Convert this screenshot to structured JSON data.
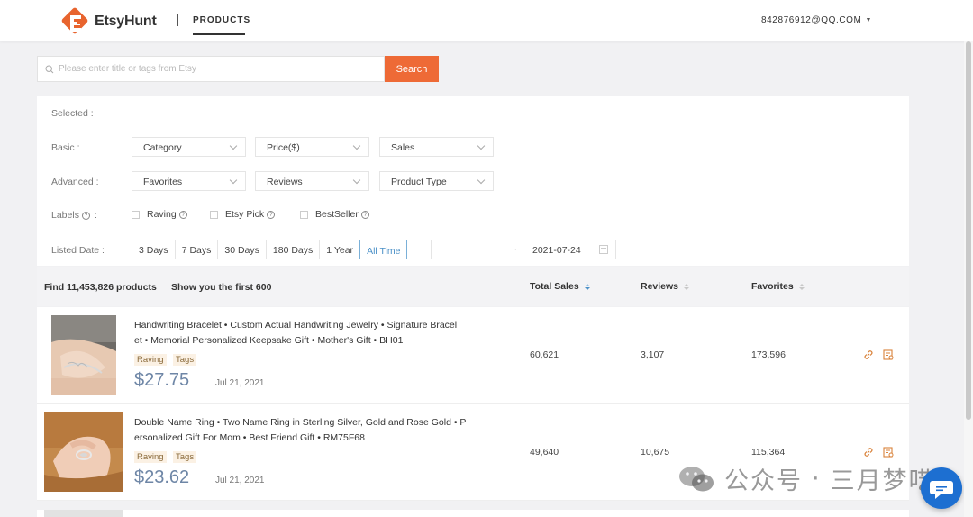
{
  "header": {
    "brand": "EtsyHunt",
    "nav_active": "PRODUCTS",
    "account": "842876912@QQ.COM"
  },
  "search": {
    "placeholder": "Please enter title or tags from Etsy",
    "value": "",
    "button": "Search"
  },
  "filters": {
    "selected_label": "Selected :",
    "basic_label": "Basic :",
    "basic": [
      "Category",
      "Price($)",
      "Sales"
    ],
    "advanced_label": "Advanced :",
    "advanced": [
      "Favorites",
      "Reviews",
      "Product Type"
    ],
    "labels_label": "Labels",
    "labels": [
      "Raving",
      "Etsy Pick",
      "BestSeller"
    ],
    "listed_date_label": "Listed Date :",
    "listed_date_options": [
      "3 Days",
      "7 Days",
      "30 Days",
      "180 Days",
      "1 Year",
      "All Time"
    ],
    "listed_date_active": "All Time",
    "date_range": {
      "start": "",
      "separator": "~",
      "end": "2021-07-24"
    }
  },
  "results": {
    "count_text": "Find 11,453,826 products",
    "limit_text": "Show you the first 600",
    "columns": [
      "Total Sales",
      "Reviews",
      "Favorites"
    ],
    "sorted_by": "Total Sales"
  },
  "products": [
    {
      "title_line1": "Handwriting Bracelet • Custom Actual Handwriting Jewelry • Signature Bracel",
      "title_line2": "et • Memorial Personalized Keepsake Gift • Mother's Gift • BH01",
      "tags": [
        "Raving",
        "Tags"
      ],
      "price": "$27.75",
      "date": "Jul 21, 2021",
      "total_sales": "60,621",
      "reviews": "3,107",
      "favorites": "173,596",
      "image": "bracelet-photo"
    },
    {
      "title_line1": "Double Name Ring • Two Name Ring in Sterling Silver, Gold and Rose Gold • P",
      "title_line2": "ersonalized Gift For Mom • Best Friend Gift • RM75F68",
      "tags": [
        "Raving",
        "Tags"
      ],
      "price": "$23.62",
      "date": "Jul 21, 2021",
      "total_sales": "49,640",
      "reviews": "10,675",
      "favorites": "115,364",
      "image": "ring-photo"
    }
  ],
  "watermark": {
    "text": "公众号",
    "dot": "·",
    "name": "三月梦呓"
  },
  "colors": {
    "accent": "#ee6a36",
    "price": "#6e86a6",
    "active_link": "#4a90c7",
    "chat": "#1d6fd1"
  }
}
